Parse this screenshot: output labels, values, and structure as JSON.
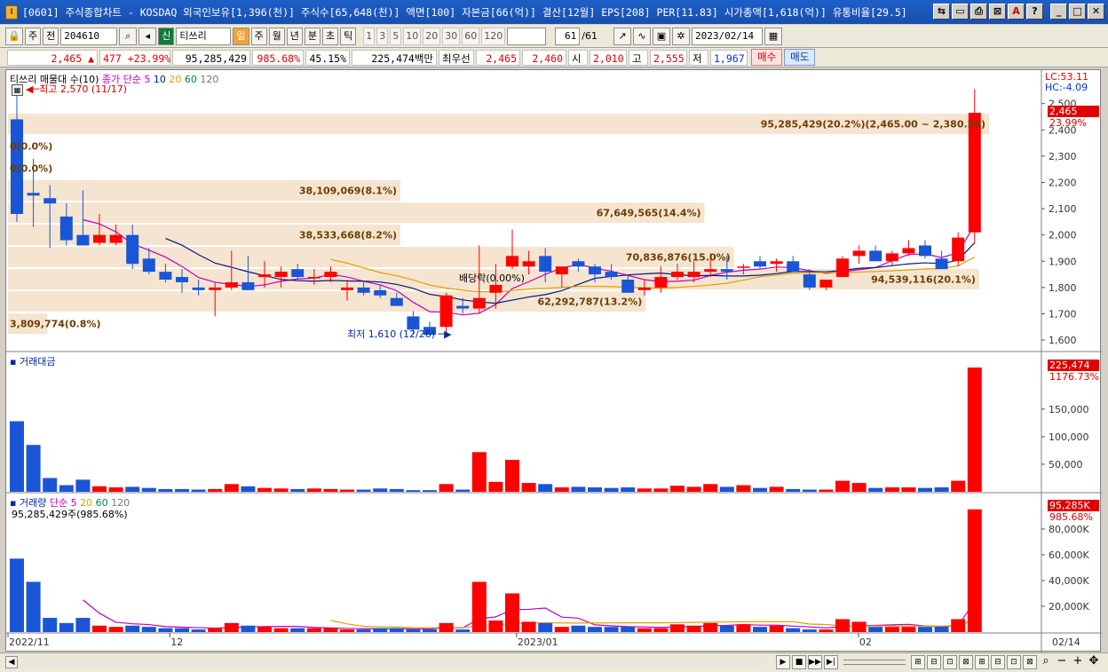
{
  "window": {
    "title": "[0601] 주식종합차트 - KOSDAQ 외국인보유[1,396(천)] 주식수[65,648(천)] 액면[100] 자본금[66(억)] 결산[12월] EPS[208] PER[11.83] 시가총액[1,618(억)] 유통비율[29.5]"
  },
  "toolbar": {
    "period": "주",
    "prev": "전",
    "code": "204610",
    "badge": "신",
    "stock_name": "티쓰리",
    "intervals": [
      "일",
      "주",
      "월",
      "년",
      "분",
      "초",
      "틱"
    ],
    "minutes": [
      "1",
      "3",
      "5",
      "10",
      "20",
      "30",
      "60",
      "120"
    ],
    "count": "61",
    "count_total": "/61",
    "date": "2023/02/14"
  },
  "quote": {
    "price": "2,465",
    "change": "477",
    "rate": "+23.99%",
    "volume": "95,285,429",
    "vol_rate": "985.68%",
    "pct2": "45.15%",
    "amount": "225,474백만",
    "best_bid_label": "최우선",
    "ask": "2,465",
    "bid": "2,460",
    "open_label": "시",
    "open": "2,010",
    "high_label": "고",
    "high": "2,555",
    "low_label": "저",
    "low": "1,967",
    "buy_label": "매수",
    "sell_label": "매도"
  },
  "colors": {
    "up": "#ff0000",
    "down": "#1a55d6",
    "ma5": "#c000c0",
    "ma10": "#001a80",
    "ma20": "#e0a000",
    "ma60": "#008a3a",
    "profile": "#f5e4cf"
  },
  "price_panel": {
    "legend_name": "티쓰리 매물대 수(10)",
    "legend_ma": "종가 단순",
    "ma_periods": [
      "5",
      "10",
      "20",
      "60",
      "120"
    ],
    "high_note": "최고 2,570 (11/17)",
    "low_note": "최저 1,610 (12/26)",
    "dividend_note": "배당락(0.00%)",
    "lc": "LC:53.11",
    "hc": "HC:-4.09",
    "last_price": "2,465",
    "last_rate": "23.99%",
    "y_ticks": [
      "2,500",
      "2,400",
      "2,300",
      "2,200",
      "2,100",
      "2,000",
      "1,900",
      "1,800",
      "1,700",
      "1,600"
    ],
    "volume_profile": [
      {
        "label": "95,285,429(20.2%)(2,465.00 ~ 2,380.50)",
        "low": 2380.5,
        "high": 2465,
        "share": 1.0
      },
      {
        "label": "0(0.0%)",
        "low": 2296,
        "high": 2380.5,
        "share": 0
      },
      {
        "label": "0(0.0%)",
        "low": 2211.5,
        "high": 2296,
        "share": 0
      },
      {
        "label": "38,109,069(8.1%)",
        "low": 2127,
        "high": 2211.5,
        "share": 0.4
      },
      {
        "label": "67,649,565(14.4%)",
        "low": 2042.5,
        "high": 2127,
        "share": 0.71
      },
      {
        "label": "38,533,668(8.2%)",
        "low": 1958,
        "high": 2042.5,
        "share": 0.4
      },
      {
        "label": "70,836,876(15.0%)",
        "low": 1873.5,
        "high": 1958,
        "share": 0.74
      },
      {
        "label": "94,539,116(20.1%)",
        "low": 1789,
        "high": 1873.5,
        "share": 0.99
      },
      {
        "label": "62,292,787(13.2%)",
        "low": 1704.5,
        "high": 1789,
        "share": 0.65
      },
      {
        "label": "3,809,774(0.8%)",
        "low": 1620,
        "high": 1704.5,
        "share": 0.04
      }
    ]
  },
  "amount_panel": {
    "legend": "거래대금",
    "last_value": "225,474",
    "last_rate": "1176.73%",
    "y_ticks": [
      "150,000",
      "100,000",
      "50,000"
    ]
  },
  "volume_panel": {
    "legend": "거래량",
    "legend_ma": "단순",
    "ma_periods": [
      "5",
      "20",
      "60",
      "120"
    ],
    "info": "95,285,429주(985.68%)",
    "last_value": "95,285K",
    "last_rate": "985.68%",
    "y_ticks": [
      "80,000K",
      "60,000K",
      "40,000K",
      "20,000K"
    ]
  },
  "x_axis": {
    "labels": [
      "2022/11",
      "12",
      "2023/01",
      "02"
    ],
    "last_date": "02/14"
  },
  "chart_data": {
    "type": "candlestick",
    "candles": [
      {
        "o": 2440,
        "h": 2570,
        "l": 2050,
        "c": 2080
      },
      {
        "o": 2160,
        "h": 2290,
        "l": 2030,
        "c": 2150
      },
      {
        "o": 2140,
        "h": 2190,
        "l": 1950,
        "c": 2120
      },
      {
        "o": 2070,
        "h": 2120,
        "l": 1960,
        "c": 1980
      },
      {
        "o": 2000,
        "h": 2170,
        "l": 1960,
        "c": 1960
      },
      {
        "o": 1970,
        "h": 2080,
        "l": 1960,
        "c": 2000
      },
      {
        "o": 1970,
        "h": 2040,
        "l": 1960,
        "c": 2000
      },
      {
        "o": 2000,
        "h": 2040,
        "l": 1870,
        "c": 1890
      },
      {
        "o": 1910,
        "h": 1950,
        "l": 1850,
        "c": 1860
      },
      {
        "o": 1860,
        "h": 1890,
        "l": 1820,
        "c": 1830
      },
      {
        "o": 1840,
        "h": 1870,
        "l": 1780,
        "c": 1820
      },
      {
        "o": 1800,
        "h": 1830,
        "l": 1770,
        "c": 1790
      },
      {
        "o": 1790,
        "h": 1820,
        "l": 1690,
        "c": 1800
      },
      {
        "o": 1800,
        "h": 1940,
        "l": 1790,
        "c": 1820
      },
      {
        "o": 1820,
        "h": 1920,
        "l": 1790,
        "c": 1790
      },
      {
        "o": 1840,
        "h": 1900,
        "l": 1800,
        "c": 1850
      },
      {
        "o": 1840,
        "h": 1880,
        "l": 1800,
        "c": 1860
      },
      {
        "o": 1870,
        "h": 1890,
        "l": 1830,
        "c": 1840
      },
      {
        "o": 1840,
        "h": 1870,
        "l": 1810,
        "c": 1840
      },
      {
        "o": 1840,
        "h": 1880,
        "l": 1820,
        "c": 1860
      },
      {
        "o": 1790,
        "h": 1830,
        "l": 1750,
        "c": 1800
      },
      {
        "o": 1800,
        "h": 1820,
        "l": 1770,
        "c": 1780
      },
      {
        "o": 1790,
        "h": 1810,
        "l": 1760,
        "c": 1770
      },
      {
        "o": 1760,
        "h": 1780,
        "l": 1740,
        "c": 1730
      },
      {
        "o": 1690,
        "h": 1710,
        "l": 1620,
        "c": 1640
      },
      {
        "o": 1650,
        "h": 1670,
        "l": 1620,
        "c": 1620
      },
      {
        "o": 1650,
        "h": 1780,
        "l": 1610,
        "c": 1770
      },
      {
        "o": 1730,
        "h": 1760,
        "l": 1700,
        "c": 1720
      },
      {
        "o": 1720,
        "h": 1960,
        "l": 1700,
        "c": 1760
      },
      {
        "o": 1780,
        "h": 1890,
        "l": 1720,
        "c": 1810
      },
      {
        "o": 1880,
        "h": 2020,
        "l": 1870,
        "c": 1920
      },
      {
        "o": 1880,
        "h": 1940,
        "l": 1850,
        "c": 1900
      },
      {
        "o": 1920,
        "h": 1950,
        "l": 1820,
        "c": 1860
      },
      {
        "o": 1850,
        "h": 1870,
        "l": 1800,
        "c": 1880
      },
      {
        "o": 1900,
        "h": 1910,
        "l": 1860,
        "c": 1880
      },
      {
        "o": 1880,
        "h": 1890,
        "l": 1820,
        "c": 1850
      },
      {
        "o": 1860,
        "h": 1890,
        "l": 1830,
        "c": 1840
      },
      {
        "o": 1830,
        "h": 1850,
        "l": 1790,
        "c": 1780
      },
      {
        "o": 1790,
        "h": 1830,
        "l": 1770,
        "c": 1800
      },
      {
        "o": 1800,
        "h": 1880,
        "l": 1780,
        "c": 1840
      },
      {
        "o": 1840,
        "h": 1890,
        "l": 1830,
        "c": 1860
      },
      {
        "o": 1840,
        "h": 1900,
        "l": 1820,
        "c": 1860
      },
      {
        "o": 1860,
        "h": 1930,
        "l": 1840,
        "c": 1870
      },
      {
        "o": 1870,
        "h": 1920,
        "l": 1830,
        "c": 1860
      },
      {
        "o": 1880,
        "h": 1890,
        "l": 1850,
        "c": 1880
      },
      {
        "o": 1900,
        "h": 1920,
        "l": 1870,
        "c": 1880
      },
      {
        "o": 1890,
        "h": 1910,
        "l": 1860,
        "c": 1900
      },
      {
        "o": 1900,
        "h": 1920,
        "l": 1860,
        "c": 1860
      },
      {
        "o": 1850,
        "h": 1870,
        "l": 1790,
        "c": 1800
      },
      {
        "o": 1800,
        "h": 1830,
        "l": 1790,
        "c": 1830
      },
      {
        "o": 1840,
        "h": 1920,
        "l": 1840,
        "c": 1910
      },
      {
        "o": 1920,
        "h": 1960,
        "l": 1890,
        "c": 1940
      },
      {
        "o": 1940,
        "h": 1960,
        "l": 1910,
        "c": 1900
      },
      {
        "o": 1900,
        "h": 1940,
        "l": 1880,
        "c": 1930
      },
      {
        "o": 1930,
        "h": 1980,
        "l": 1920,
        "c": 1950
      },
      {
        "o": 1960,
        "h": 1980,
        "l": 1910,
        "c": 1920
      },
      {
        "o": 1910,
        "h": 1940,
        "l": 1870,
        "c": 1870
      },
      {
        "o": 1900,
        "h": 2010,
        "l": 1880,
        "c": 1990
      },
      {
        "o": 2010,
        "h": 2555,
        "l": 1967,
        "c": 2465
      }
    ],
    "amount": [
      128000,
      85000,
      25000,
      12000,
      22000,
      10000,
      8000,
      9000,
      7000,
      5000,
      5000,
      4000,
      5000,
      14000,
      10000,
      7000,
      6000,
      5000,
      6000,
      5000,
      4000,
      4000,
      6000,
      5000,
      3000,
      3000,
      14000,
      4000,
      72000,
      18000,
      58000,
      16000,
      14000,
      8000,
      9000,
      8000,
      7000,
      8000,
      6000,
      6000,
      11000,
      9000,
      14000,
      9000,
      12000,
      7000,
      9000,
      5000,
      4000,
      4000,
      20000,
      16000,
      7000,
      8000,
      8000,
      7000,
      8000,
      20000,
      225474
    ],
    "volume": [
      57000,
      39000,
      11000,
      7000,
      11000,
      5000,
      4000,
      5000,
      4000,
      3000,
      3000,
      2000,
      3000,
      7000,
      5000,
      4000,
      3000,
      3000,
      3000,
      3000,
      2000,
      2000,
      3000,
      3000,
      2000,
      2000,
      7000,
      2000,
      39000,
      9000,
      30000,
      8000,
      7000,
      4000,
      5000,
      4000,
      4000,
      4000,
      3000,
      3000,
      6000,
      5000,
      7000,
      5000,
      6000,
      4000,
      5000,
      3000,
      2000,
      2000,
      10000,
      8000,
      4000,
      4000,
      4000,
      4000,
      4000,
      10000,
      95285
    ]
  }
}
